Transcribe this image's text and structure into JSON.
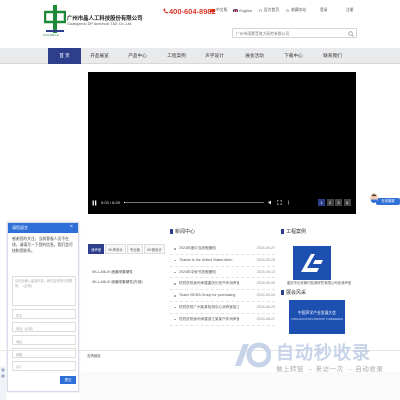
{
  "header": {
    "logo_sub": "ANCHECH",
    "company_cn": "广州市晶人工科技股份有限公司",
    "company_en": "Guangzhou DP Anechoic T&E Co.,Ltd.",
    "hotline": "400-604-8982",
    "toplinks": [
      "中文版",
      "English",
      "设为首页",
      "收藏本站"
    ],
    "login": "登录",
    "register": "注册",
    "search_placeholder": "广州市雨蒙音效大研究有限公司"
  },
  "nav": {
    "items": [
      "首  页",
      "开品展览",
      "产品中心",
      "工程案例",
      "声学设计",
      "展会活动",
      "下载中心",
      "联系我们"
    ]
  },
  "video": {
    "breadcrumb": "",
    "time": "0:03 / 6:29",
    "progress": 0.01,
    "slides": [
      "1",
      "2",
      "3",
      "4"
    ],
    "active_slide": "1"
  },
  "cs_float": {
    "label": "在线客服"
  },
  "chat": {
    "title": "请您留言",
    "close": "×",
    "message": "感谢您的关注，当前客服人员不在线，请填写一下您的信息，我们会尽快和您联系。",
    "textarea_placeholder": "请在此输入留言内容，我们会尽快与您联系。（必填）",
    "fields": [
      "姓名",
      "电话（必填）",
      "地址",
      "邮箱",
      "QQ"
    ],
    "submit": "提交"
  },
  "products": {
    "tabs": [
      "消声室",
      "XK声设计",
      "专业版",
      "XK音设计"
    ],
    "items": [
      "XK-LJ46-XI 面膜采集硬件",
      "XK-LJ46-XI 面膜采集硬件(外部)"
    ]
  },
  "news": {
    "title": "新闻中心",
    "rows": [
      {
        "title": "2024年度中当放假通知",
        "date": "2024-09-27"
      },
      {
        "title": "Thanks to the United States Alten",
        "date": "2024-09-25"
      },
      {
        "title": "2024年中秋节放假通知",
        "date": "2024-09-13"
      },
      {
        "title": "热烈庆祝我司承建重庆长安汽车消声室",
        "date": "2024-09-05"
      },
      {
        "title": "Thank ISKRA Group for purchasing",
        "date": "2024-09-04"
      },
      {
        "title": "热烈庆祝广州某某检测中心消声室竣工",
        "date": "2024-08-23"
      },
      {
        "title": "热烈庆祝我司承建浙江某某汽车消声室",
        "date": "2024-08-21"
      }
    ]
  },
  "cases": {
    "title": "工程案例",
    "caption": "重庆市长安铸巧检测研究有限公司全消声室"
  },
  "honor": {
    "title": "展会风采",
    "img_title": "中国声学产业发展大会",
    "img_sub": "CHINA ACOUSTICS INDUSTRY CONFERENCE"
  },
  "footer": {
    "link": "友情链接"
  },
  "watermark": {
    "text": "自动秒收录",
    "sub": "做上转链 → 来访一次 → 自动收录"
  },
  "colors": {
    "brand": "#2c3e8c",
    "accent": "#d9372b",
    "chat": "#2f6fd8",
    "logo_green": "#1d8a3a"
  }
}
